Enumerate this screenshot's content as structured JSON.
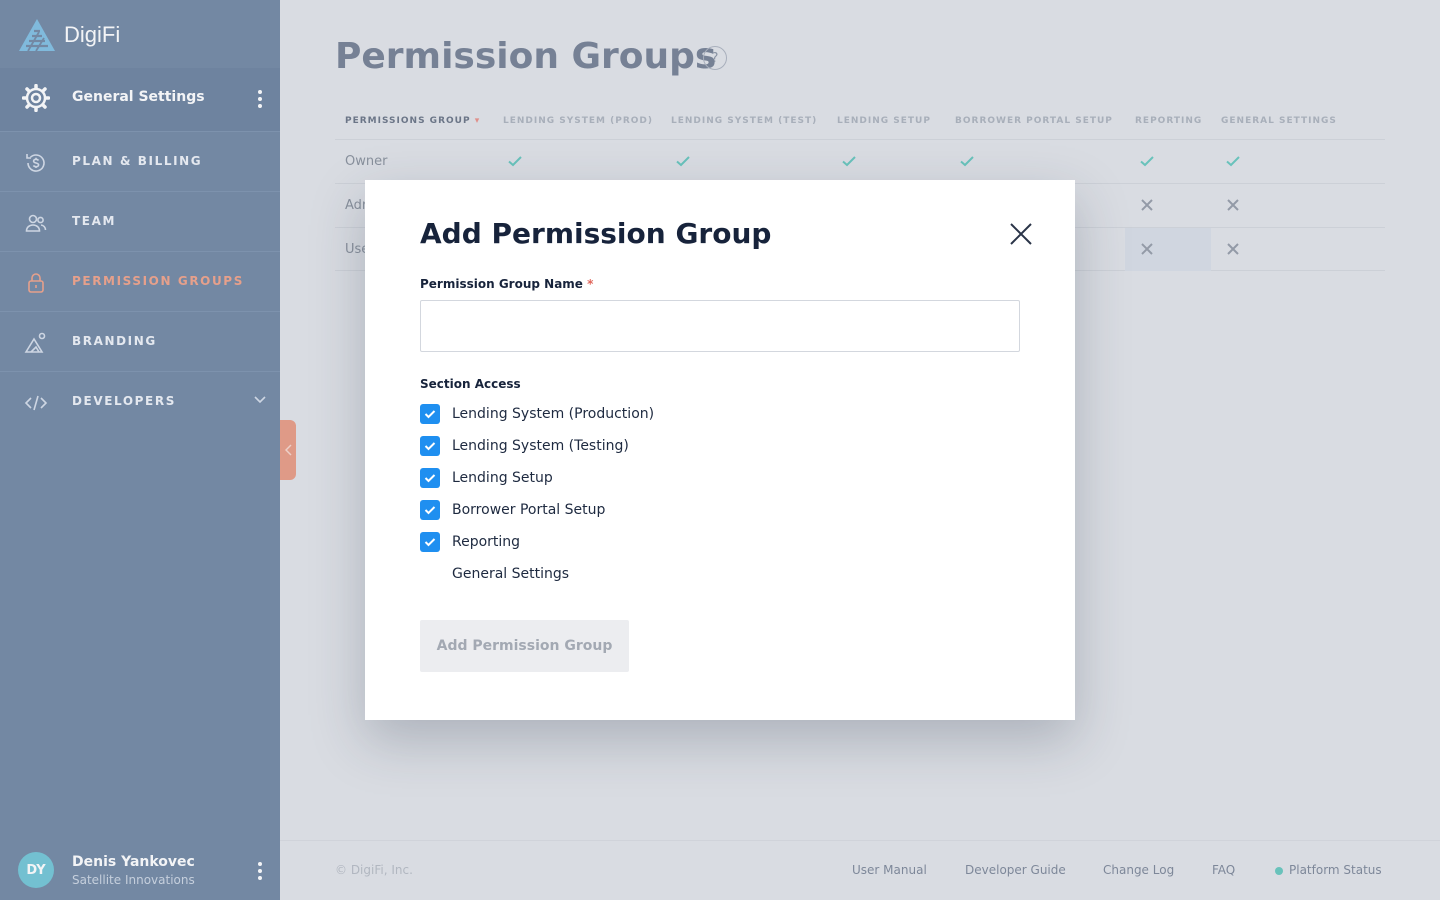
{
  "app": {
    "name": "DigiFi"
  },
  "sidebar": {
    "header_label": "General Settings",
    "items": [
      {
        "label": "PLAN & BILLING",
        "icon": "dollar-cycle-icon",
        "active": false
      },
      {
        "label": "TEAM",
        "icon": "team-icon",
        "active": false
      },
      {
        "label": "PERMISSION GROUPS",
        "icon": "lock-icon",
        "active": true
      },
      {
        "label": "BRANDING",
        "icon": "branding-icon",
        "active": false
      },
      {
        "label": "DEVELOPERS",
        "icon": "code-icon",
        "active": false
      }
    ],
    "user": {
      "initials": "DY",
      "name": "Denis Yankovec",
      "org": "Satellite Innovations"
    }
  },
  "page": {
    "title": "Permission Groups",
    "help": "?",
    "columns": [
      "PERMISSIONS GROUP",
      "LENDING SYSTEM (PROD)",
      "LENDING SYSTEM (TEST)",
      "LENDING SETUP",
      "BORROWER PORTAL SETUP",
      "REPORTING",
      "GENERAL SETTINGS"
    ],
    "rows": [
      {
        "name": "Owner",
        "marks": [
          "check",
          "check",
          "check",
          "check",
          "check",
          "check"
        ]
      },
      {
        "name": "Adr",
        "marks": [
          "",
          "",
          "",
          "",
          "cross",
          "cross"
        ]
      },
      {
        "name": "Use",
        "marks": [
          "",
          "",
          "",
          "",
          "cross",
          "cross"
        ]
      }
    ]
  },
  "footer": {
    "copyright": "© DigiFi, Inc.",
    "links": [
      "User Manual",
      "Developer Guide",
      "Change Log",
      "FAQ",
      "Platform Status"
    ]
  },
  "modal": {
    "title": "Add Permission Group",
    "name_label": "Permission Group Name",
    "required_mark": "*",
    "name_value": "",
    "section_label": "Section Access",
    "options": [
      {
        "label": "Lending System (Production)",
        "checked": true
      },
      {
        "label": "Lending System (Testing)",
        "checked": true
      },
      {
        "label": "Lending Setup",
        "checked": true
      },
      {
        "label": "Borrower Portal Setup",
        "checked": true
      },
      {
        "label": "Reporting",
        "checked": true
      },
      {
        "label": "General Settings",
        "checked": false
      }
    ],
    "submit_label": "Add Permission Group"
  },
  "colors": {
    "sidebar": "#3b5a80",
    "accent": "#ec7e5b",
    "checkbox": "#1f8ff0",
    "check": "#2bb3a5"
  }
}
